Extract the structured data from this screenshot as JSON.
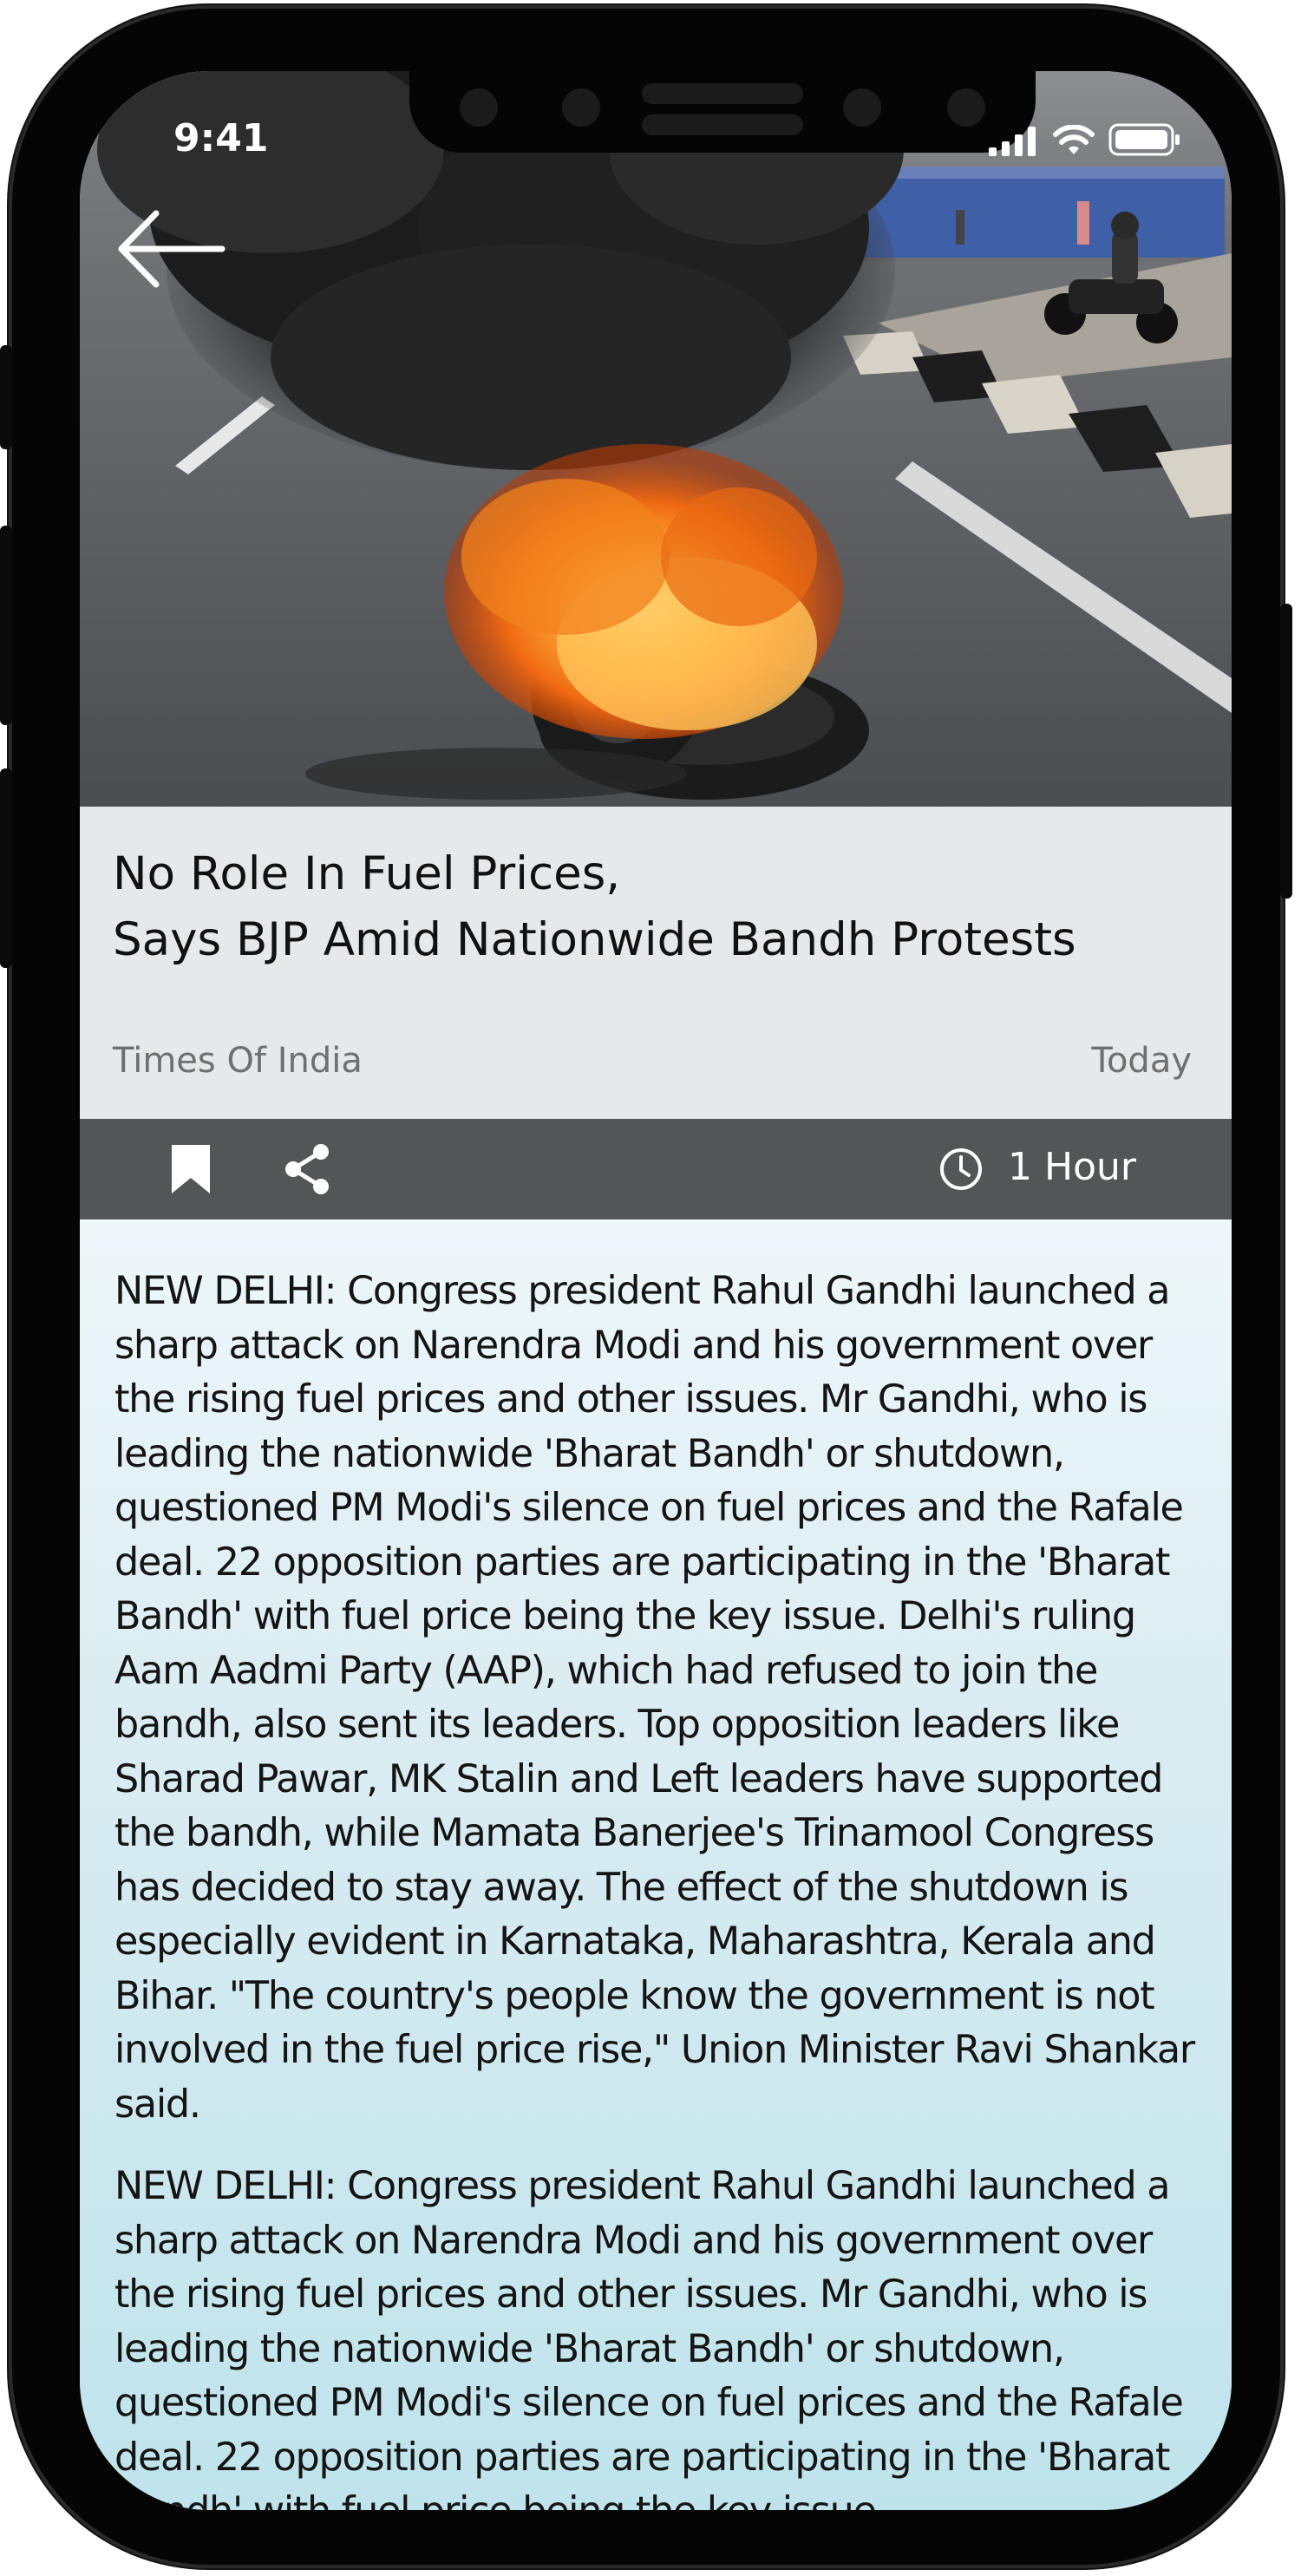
{
  "status_bar": {
    "time": "9:41"
  },
  "navigation": {
    "back_icon": "arrow-left-icon"
  },
  "article": {
    "image_description_icon": "hero-photo",
    "headline_line1": "No Role In Fuel Prices,",
    "headline_line2": "Says BJP Amid Nationwide Bandh Protests",
    "source": "Times Of India",
    "date": "Today",
    "read_time": "1 Hour",
    "paragraphs": [
      "NEW DELHI:  Congress president Rahul Gandhi launched a sharp attack on Narendra Modi and his government over the rising fuel prices and other issues. Mr Gandhi, who is leading the nationwide 'Bharat Bandh' or shutdown, questioned PM Modi's silence on fuel prices and the Rafale deal. 22 opposition parties are participating in the 'Bharat Bandh' with fuel price being the key issue. Delhi's ruling Aam Aadmi Party (AAP), which had refused to join the bandh, also sent its leaders. Top opposition leaders like Sharad Pawar, MK Stalin and Left leaders have supported the bandh, while Mamata Banerjee's Trinamool Congress has decided to stay away. The effect of the shutdown is especially evident in Karnataka, Maharashtra, Kerala and Bihar. \"The country's people know the government is not involved in the fuel price rise,\" Union Minister Ravi Shankar said.",
      "NEW DELHI:  Congress president Rahul Gandhi launched a sharp attack on Narendra Modi and his government over the rising fuel prices and other issues. Mr Gandhi, who is leading the nationwide 'Bharat Bandh' or shutdown, questioned PM Modi's silence on fuel prices and the Rafale deal. 22 opposition parties are participating in the 'Bharat Bandh' with fuel price being the key issue."
    ]
  },
  "actions": {
    "bookmark_icon": "bookmark-icon",
    "share_icon": "share-icon",
    "clock_icon": "clock-icon"
  },
  "colors": {
    "action_bar": "#545556",
    "headline_bg": "#e7e8e9",
    "article_bg_top": "#eef7fa",
    "article_bg_bottom": "#bfe3ec"
  }
}
